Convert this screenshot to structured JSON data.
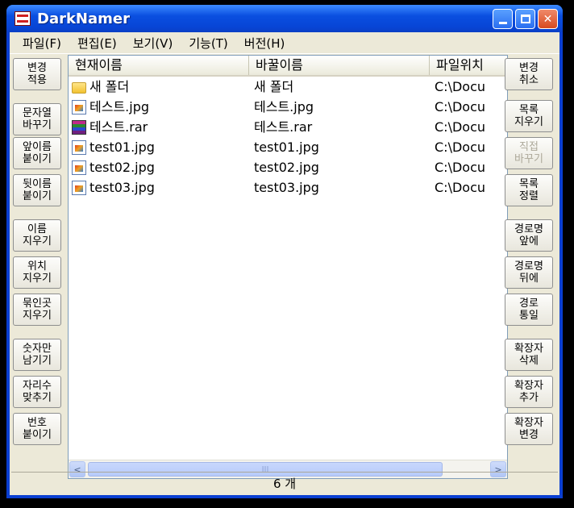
{
  "window": {
    "title": "DarkNamer"
  },
  "menu": [
    "파일(F)",
    "편집(E)",
    "보기(V)",
    "기능(T)",
    "버전(H)"
  ],
  "left_buttons": [
    {
      "label": "변경\n적용",
      "enabled": true
    },
    {
      "label": "문자열\n바꾸기",
      "enabled": true
    },
    {
      "label": "앞이름\n붙이기",
      "enabled": true
    },
    {
      "label": "뒷이름\n붙이기",
      "enabled": true
    },
    {
      "label": "이름\n지우기",
      "enabled": true
    },
    {
      "label": "위치\n지우기",
      "enabled": true
    },
    {
      "label": "묶인곳\n지우기",
      "enabled": true
    },
    {
      "label": "숫자만\n남기기",
      "enabled": true
    },
    {
      "label": "자리수\n맞추기",
      "enabled": true
    },
    {
      "label": "번호\n붙이기",
      "enabled": true
    }
  ],
  "right_buttons": [
    {
      "label": "변경\n취소",
      "enabled": true
    },
    {
      "label": "목록\n지우기",
      "enabled": true
    },
    {
      "label": "직접\n바꾸기",
      "enabled": false
    },
    {
      "label": "목록\n정렬",
      "enabled": true
    },
    {
      "label": "경로명\n앞에",
      "enabled": true
    },
    {
      "label": "경로명\n뒤에",
      "enabled": true
    },
    {
      "label": "경로\n통일",
      "enabled": true
    },
    {
      "label": "확장자\n삭제",
      "enabled": true
    },
    {
      "label": "확장자\n추가",
      "enabled": true
    },
    {
      "label": "확장자\n변경",
      "enabled": true
    }
  ],
  "list": {
    "columns": [
      "현재이름",
      "바꿀이름",
      "파일위치"
    ],
    "rows": [
      {
        "icon": "folder-icon",
        "current": "새 폴더",
        "new": "새 폴더",
        "location": "C:\\Docu"
      },
      {
        "icon": "jpg-file-icon",
        "current": "테스트.jpg",
        "new": "테스트.jpg",
        "location": "C:\\Docu"
      },
      {
        "icon": "rar-file-icon",
        "current": "테스트.rar",
        "new": "테스트.rar",
        "location": "C:\\Docu"
      },
      {
        "icon": "jpg-file-icon",
        "current": "test01.jpg",
        "new": "test01.jpg",
        "location": "C:\\Docu"
      },
      {
        "icon": "jpg-file-icon",
        "current": "test02.jpg",
        "new": "test02.jpg",
        "location": "C:\\Docu"
      },
      {
        "icon": "jpg-file-icon",
        "current": "test03.jpg",
        "new": "test03.jpg",
        "location": "C:\\Docu"
      }
    ]
  },
  "scrollbar": {
    "left_arrow": "<",
    "right_arrow": ">",
    "thumb_grip": "III"
  },
  "status": {
    "count": "6 개"
  }
}
